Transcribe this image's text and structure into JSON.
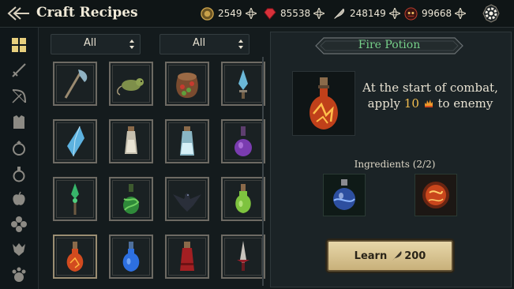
{
  "header": {
    "title": "Craft Recipes"
  },
  "resources": [
    {
      "name": "gold",
      "icon": "gold-coin-icon",
      "value": "2549",
      "color": "#c9a14a"
    },
    {
      "name": "gems",
      "icon": "red-gem-icon",
      "value": "85538",
      "color": "#d8313a"
    },
    {
      "name": "feathers",
      "icon": "feather-quill-icon",
      "value": "248149",
      "color": "#c9c4ba"
    },
    {
      "name": "essence",
      "icon": "demon-skull-icon",
      "value": "99668",
      "color": "#b8342c"
    }
  ],
  "filters": {
    "category": "All",
    "type": "All"
  },
  "sidebar": {
    "items": [
      {
        "icon": "grid-icon",
        "active": true
      },
      {
        "icon": "sword-icon"
      },
      {
        "icon": "bow-icon"
      },
      {
        "icon": "armor-icon"
      },
      {
        "icon": "ring-icon"
      },
      {
        "icon": "potion-icon"
      },
      {
        "icon": "apple-icon"
      },
      {
        "icon": "clover-icon"
      },
      {
        "icon": "beast-icon"
      },
      {
        "icon": "pet-paw-icon"
      }
    ]
  },
  "recipes": [
    {
      "icon": "battle-axe-icon"
    },
    {
      "icon": "rat-icon"
    },
    {
      "icon": "berry-sack-icon"
    },
    {
      "icon": "crystal-dagger-icon"
    },
    {
      "icon": "ice-crystal-icon"
    },
    {
      "icon": "bone-bottle-icon"
    },
    {
      "icon": "frost-bottle-icon"
    },
    {
      "icon": "purple-potion-icon"
    },
    {
      "icon": "emerald-spear-icon"
    },
    {
      "icon": "green-vine-potion-icon"
    },
    {
      "icon": "crow-icon"
    },
    {
      "icon": "green-potion-icon"
    },
    {
      "icon": "fire-potion-icon",
      "selected": true
    },
    {
      "icon": "blue-potion-icon"
    },
    {
      "icon": "blood-potion-icon"
    },
    {
      "icon": "crimson-blade-icon"
    }
  ],
  "detail": {
    "title": "Fire Potion",
    "description_before": "At the start of combat, apply ",
    "description_amount": "10",
    "description_after": " to enemy",
    "status_icon": "burn-flame-icon",
    "ingredients_label": "Ingredients (2/2)",
    "ingredients": [
      {
        "icon": "mana-flask-icon"
      },
      {
        "icon": "fire-orb-icon"
      }
    ],
    "learn_label": "Learn",
    "learn_cost": "200",
    "learn_cost_icon": "feather-quill-icon"
  }
}
